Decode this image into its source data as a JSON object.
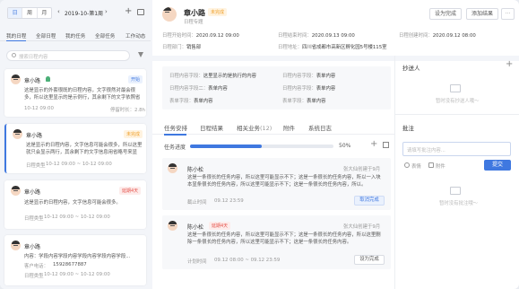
{
  "left": {
    "view_toggle": [
      "日",
      "周",
      "月"
    ],
    "date_label": "2019-10-第1周",
    "tabs": [
      "我的日程",
      "全部日程",
      "我的任务",
      "全部任务",
      "工作动态"
    ],
    "search_placeholder": "搜索日程内容",
    "cards": [
      {
        "name": "章小路",
        "badge": "开始",
        "content": "这是显示的外套很既的日程内容，文字很然对最会很多，所以这里显示的是示例行，其余剩下的文字依照省略号来...",
        "time": "10-12 09:00",
        "extra": "停留时长：2.8h"
      },
      {
        "name": "章小路",
        "badge": "未完成",
        "content": "这是显示的日程内容，文字信息可能会很多，所以这里就只会显示两行，其余剩下的文字信息用省略号来显示...",
        "type_label": "日程类型",
        "time": "10-12 09:00 ~ 10-12 09:00"
      },
      {
        "name": "章小路",
        "badge": "延期4天",
        "content": "这是显示的日程内容，文字信息可能会很多。",
        "type_label": "日程类型",
        "time": "10-12 09:00 ~ 10-12 09:00"
      },
      {
        "name": "章小路",
        "content": "内容：学段内容学段内容学段内容学段内容学段...",
        "phone_label": "客户电话：",
        "phone": "15928677887",
        "type_label": "日程类型",
        "time": "10-12 09:00 ~ 10-12 09:00"
      }
    ]
  },
  "header": {
    "name": "章小路",
    "status": "未完成",
    "subtitle": "日程专题",
    "btn_complete": "设为完成",
    "btn_add_result": "添加结果",
    "more": "···",
    "row1": [
      {
        "label": "日程开始时间：",
        "value": "2020.09.12 09:00"
      },
      {
        "label": "日程结束时间：",
        "value": "2020.09.13 09:00"
      },
      {
        "label": "日程创建时间：",
        "value": "2020.09.12 08:00"
      }
    ],
    "row2": [
      {
        "label": "日程部门：",
        "value": "销售部"
      },
      {
        "label": "日程地址：",
        "value": "四川省成都市高新区孵化园5号楼115室"
      }
    ]
  },
  "form_fields": [
    {
      "label": "日程内容字段：",
      "value": "这里显示的是执行的内容"
    },
    {
      "label": "日程内容字段：",
      "value": "表单内容"
    },
    {
      "label": "日程内容字段二：",
      "value": "表单内容"
    },
    {
      "label": "日程内容字段：",
      "value": "表单内容"
    },
    {
      "label": "表单字段：",
      "value": "表单内容"
    },
    {
      "label": "表单字段：",
      "value": "表单内容"
    }
  ],
  "detail_tabs": {
    "items": [
      "任务安排",
      "日程结果",
      "相关业务",
      "附件",
      "系统日志"
    ],
    "count": "(12)"
  },
  "progress": {
    "label": "任务进度",
    "value": "50%",
    "fraction": 0.5
  },
  "tasks": [
    {
      "name": "陈小松",
      "assignee": "张大仙创建于9月",
      "content": "这是一条很长的任务内容，所以这里可能显示不下；这是一条很长的任务内容，所以一入块本显条很长的任务内容，所以这里可能显示不下；这是一条很长的任务内容，所以。",
      "time_label": "截止时间",
      "time": "09.12 23:59",
      "action": "取消完成"
    },
    {
      "name": "陈小松",
      "badge": "延期4天",
      "assignee": "张大仙创建于9月",
      "content": "这是一条很长的任务内容，所以这里可能显示不下；这是一条很长的任务内容，所以这里删除一条很长的任务内容，所以这里可能显示不下；这是一条很长的任务内容。",
      "time_label": "计划时间",
      "time": "09.12 08:00 ~ 09.12 23:59",
      "action": "设为完成"
    }
  ],
  "right": {
    "cc_title": "抄送人",
    "cc_empty": "暂时没有抄送人哦～",
    "note_title": "批注",
    "note_placeholder": "请填写批注内容...",
    "emoji_label": "表情",
    "attach_label": "附件",
    "send_label": "提交",
    "note_empty": "暂时没有批注哦～"
  },
  "colors": {
    "accent": "#3f78e0",
    "orange": "#f0a02a",
    "red": "#e5534b"
  }
}
